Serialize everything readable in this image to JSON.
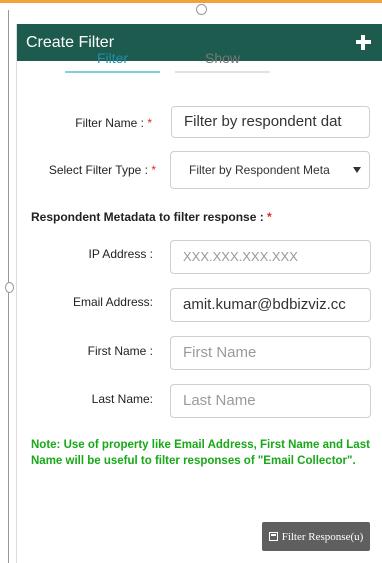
{
  "header": {
    "title": "Create Filter",
    "add_icon": "plus-icon"
  },
  "tabs": [
    {
      "label": "Filter",
      "active": true
    },
    {
      "label": "Show",
      "active": false
    }
  ],
  "form": {
    "filter_name": {
      "label": "Filter Name :",
      "required_mark": "*",
      "value": "Filter by respondent dat"
    },
    "filter_type": {
      "label": "Select Filter Type :",
      "required_mark": "*",
      "value": "Filter by Respondent Meta"
    },
    "metadata_section": {
      "title": "Respondent Metadata to filter response :",
      "required_mark": "*"
    },
    "ip_address": {
      "label": "IP Address :",
      "placeholder": "XXX.XXX.XXX.XXX"
    },
    "email_address": {
      "label": "Email Address:",
      "value": "amit.kumar@bdbizviz.cc"
    },
    "first_name": {
      "label": "First Name :",
      "placeholder": "First Name"
    },
    "last_name": {
      "label": "Last Name:",
      "placeholder": "Last Name"
    }
  },
  "note": "Note: Use of property like Email Address, First Name and Last Name will be useful to filter responses of \"Email Collector\".",
  "button": {
    "label": "Filter Response(u)",
    "icon": "save-icon"
  },
  "colors": {
    "header": "#1e5b4f",
    "active_tab": "#1e8fa8",
    "note": "#18a818",
    "required": "#e8231e",
    "button": "#5f5f5f",
    "top_accent": "#f2a23a"
  }
}
